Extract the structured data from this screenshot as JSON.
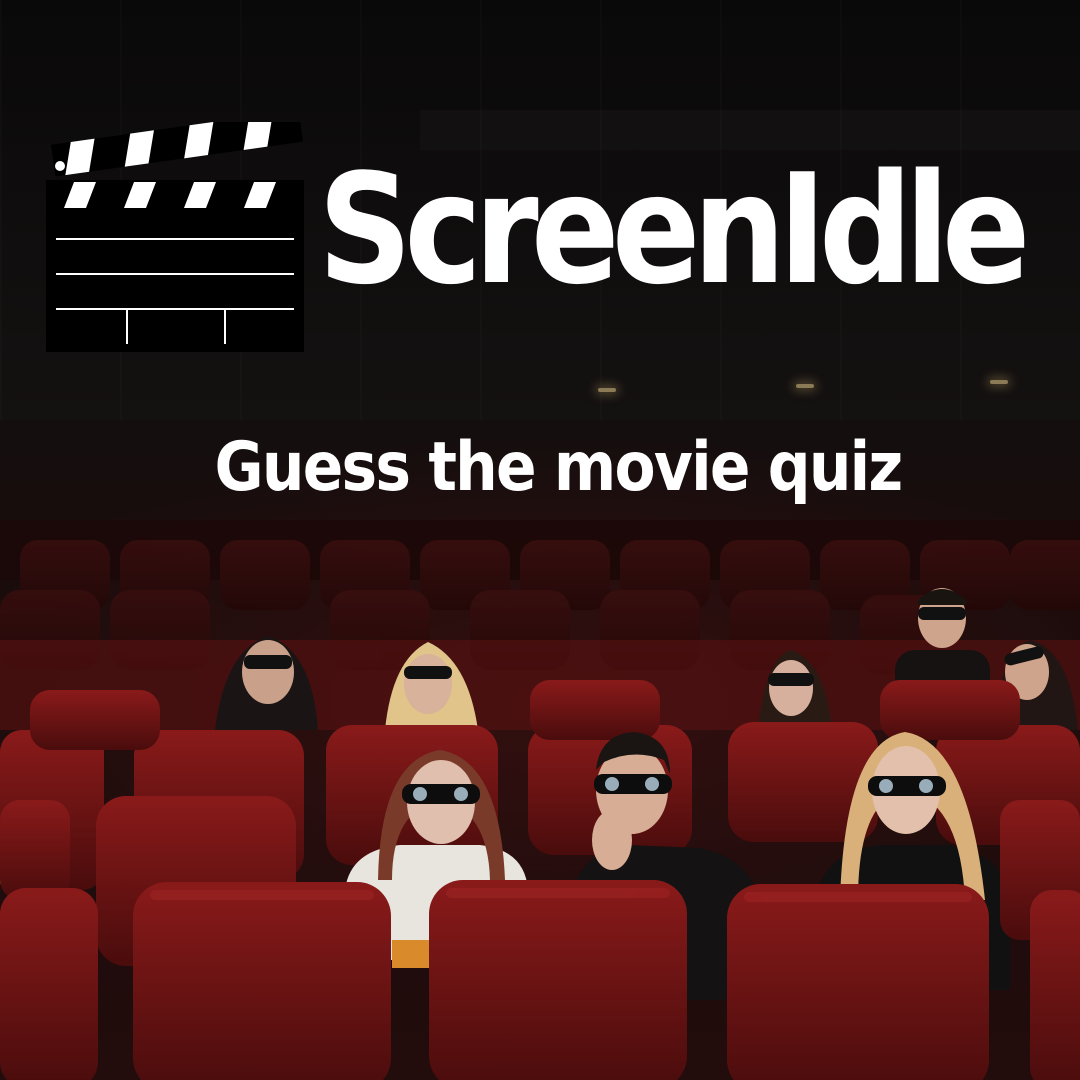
{
  "brand": {
    "title": "ScreenIdle",
    "logo_icon": "clapperboard-icon"
  },
  "tagline": "Guess the movie quiz",
  "colors": {
    "text": "#ffffff",
    "seat": "#7a1414",
    "seat_shadow": "#3a0808",
    "background": "#0d0b0b"
  }
}
